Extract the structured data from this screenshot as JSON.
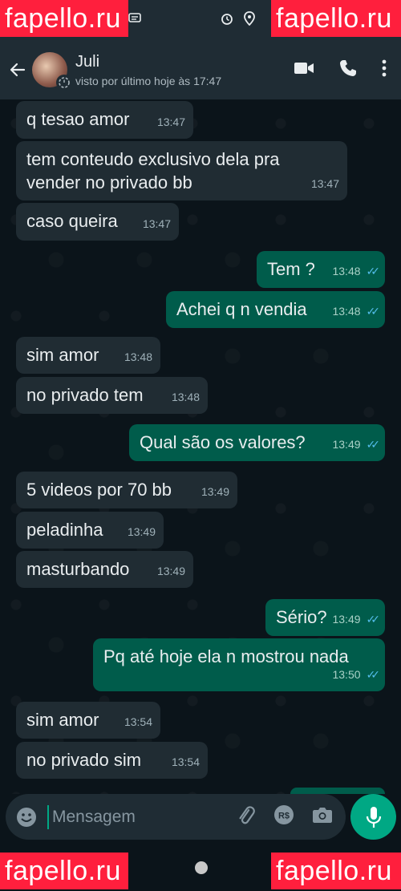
{
  "watermark": {
    "text": "fapello.ru"
  },
  "header": {
    "contact_name": "Juli",
    "contact_status": "visto por último hoje às 17:47"
  },
  "messages": [
    {
      "dir": "in",
      "text": "q tesao amor",
      "time": "13:47"
    },
    {
      "dir": "in",
      "text": "tem conteudo exclusivo dela pra vender no privado bb",
      "time": "13:47"
    },
    {
      "dir": "in",
      "text": "caso queira",
      "time": "13:47"
    },
    {
      "dir": "out",
      "text": "Tem ?",
      "time": "13:48"
    },
    {
      "dir": "out",
      "text": "Achei q n vendia",
      "time": "13:48"
    },
    {
      "dir": "in",
      "text": "sim amor",
      "time": "13:48"
    },
    {
      "dir": "in",
      "text": "no privado tem",
      "time": "13:48"
    },
    {
      "dir": "out",
      "text": "Qual são os valores?",
      "time": "13:49"
    },
    {
      "dir": "in",
      "text": "5 videos por 70 bb",
      "time": "13:49"
    },
    {
      "dir": "in",
      "text": "peladinha",
      "time": "13:49"
    },
    {
      "dir": "in",
      "text": "masturbando",
      "time": "13:49"
    },
    {
      "dir": "out",
      "text": "Sério?",
      "time": "13:49"
    },
    {
      "dir": "out",
      "text": "Pq até hoje ela n mostrou nada",
      "time": "13:50"
    },
    {
      "dir": "in",
      "text": "sim amor",
      "time": "13:54"
    },
    {
      "dir": "in",
      "text": "no privado sim",
      "time": "13:54"
    }
  ],
  "composer": {
    "placeholder": "Mensagem"
  },
  "colors": {
    "accent": "#00a884",
    "outgoing": "#005c4b",
    "incoming": "#202c33",
    "read_ticks": "#53bdeb"
  },
  "icons": [
    "back-arrow-icon",
    "video-call-icon",
    "phone-icon",
    "more-options-icon",
    "emoji-icon",
    "attach-icon",
    "payment-icon",
    "camera-icon",
    "mic-icon"
  ]
}
